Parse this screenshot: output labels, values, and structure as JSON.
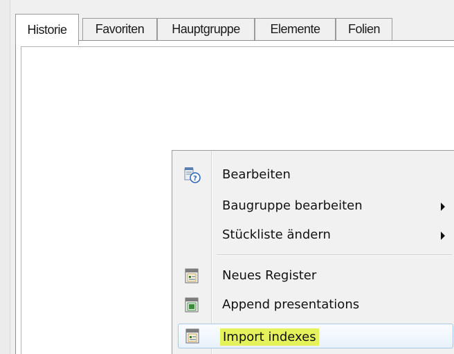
{
  "tabs": [
    {
      "label": "Historie",
      "active": true
    },
    {
      "label": "Favoriten",
      "active": false
    },
    {
      "label": "Hauptgruppe",
      "active": false
    },
    {
      "label": "Elemente",
      "active": false
    },
    {
      "label": "Folien",
      "active": false
    }
  ],
  "context_menu": {
    "items": [
      {
        "label": "Bearbeiten",
        "icon": "edit-help-icon",
        "submenu": false
      },
      {
        "label": "Baugruppe bearbeiten",
        "icon": null,
        "submenu": true
      },
      {
        "label": "Stückliste ändern",
        "icon": null,
        "submenu": true
      },
      {
        "label": "Neues Register",
        "icon": "register-icon",
        "submenu": false
      },
      {
        "label": "Append presentations",
        "icon": "presentation-icon",
        "submenu": false
      },
      {
        "label": "Import indexes",
        "icon": "register-icon",
        "submenu": false,
        "hovered": true,
        "highlight_color": "#e5f25c"
      }
    ]
  },
  "colors": {
    "accent_hover_border": "#a8c8ea",
    "highlight": "#e5f25c"
  }
}
